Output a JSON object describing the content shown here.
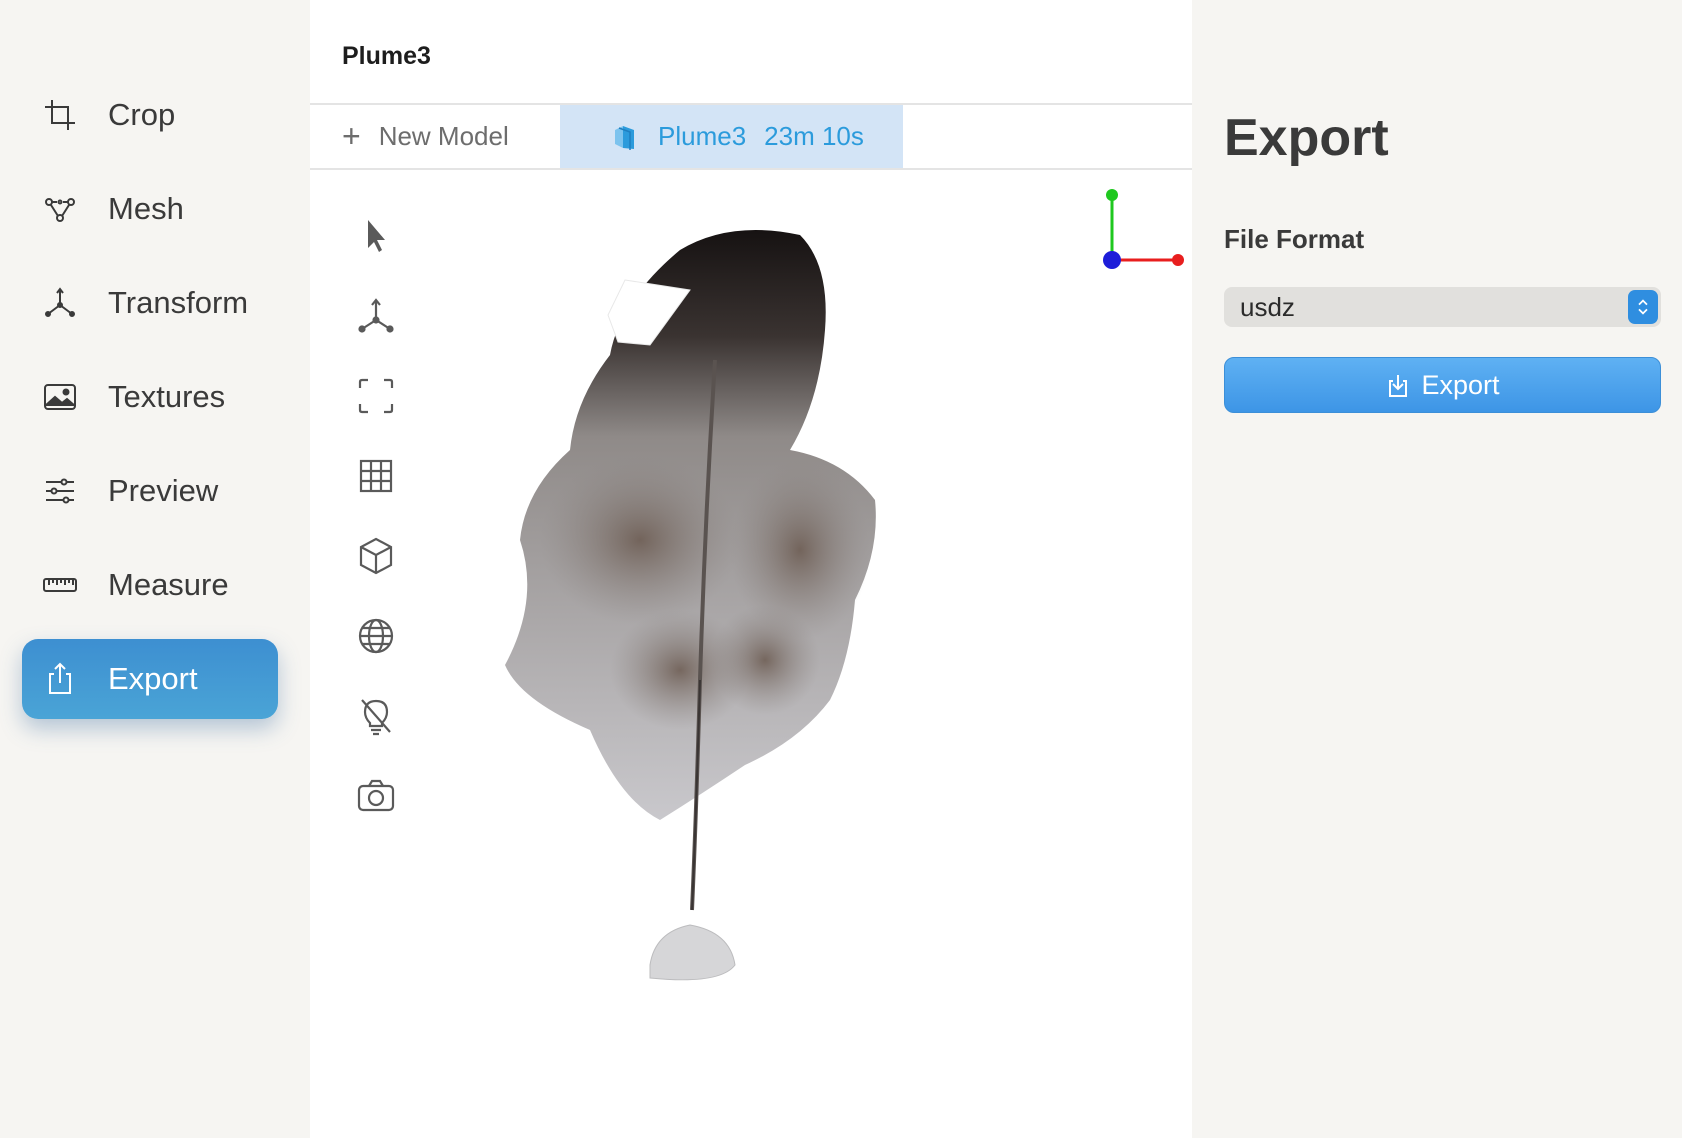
{
  "window": {
    "title": "Plume3"
  },
  "sidebar": {
    "items": [
      {
        "label": "Crop",
        "icon": "crop-icon",
        "active": false
      },
      {
        "label": "Mesh",
        "icon": "mesh-icon",
        "active": false
      },
      {
        "label": "Transform",
        "icon": "transform-icon",
        "active": false
      },
      {
        "label": "Textures",
        "icon": "image-icon",
        "active": false
      },
      {
        "label": "Preview",
        "icon": "sliders-icon",
        "active": false
      },
      {
        "label": "Measure",
        "icon": "ruler-icon",
        "active": false
      },
      {
        "label": "Export",
        "icon": "share-icon",
        "active": true
      }
    ],
    "active_color": "#3d8fd1"
  },
  "tabs": {
    "new_label": "New Model",
    "model_name": "Plume3",
    "model_time": "23m 10s"
  },
  "tools": [
    "pointer-icon",
    "axes-icon",
    "frame-icon",
    "grid-icon",
    "cube-icon",
    "globe-icon",
    "light-off-icon",
    "camera-icon"
  ],
  "export_panel": {
    "title": "Export",
    "file_format_label": "File Format",
    "file_format_value": "usdz",
    "export_button_label": "Export",
    "accent": "#3d95e6"
  }
}
